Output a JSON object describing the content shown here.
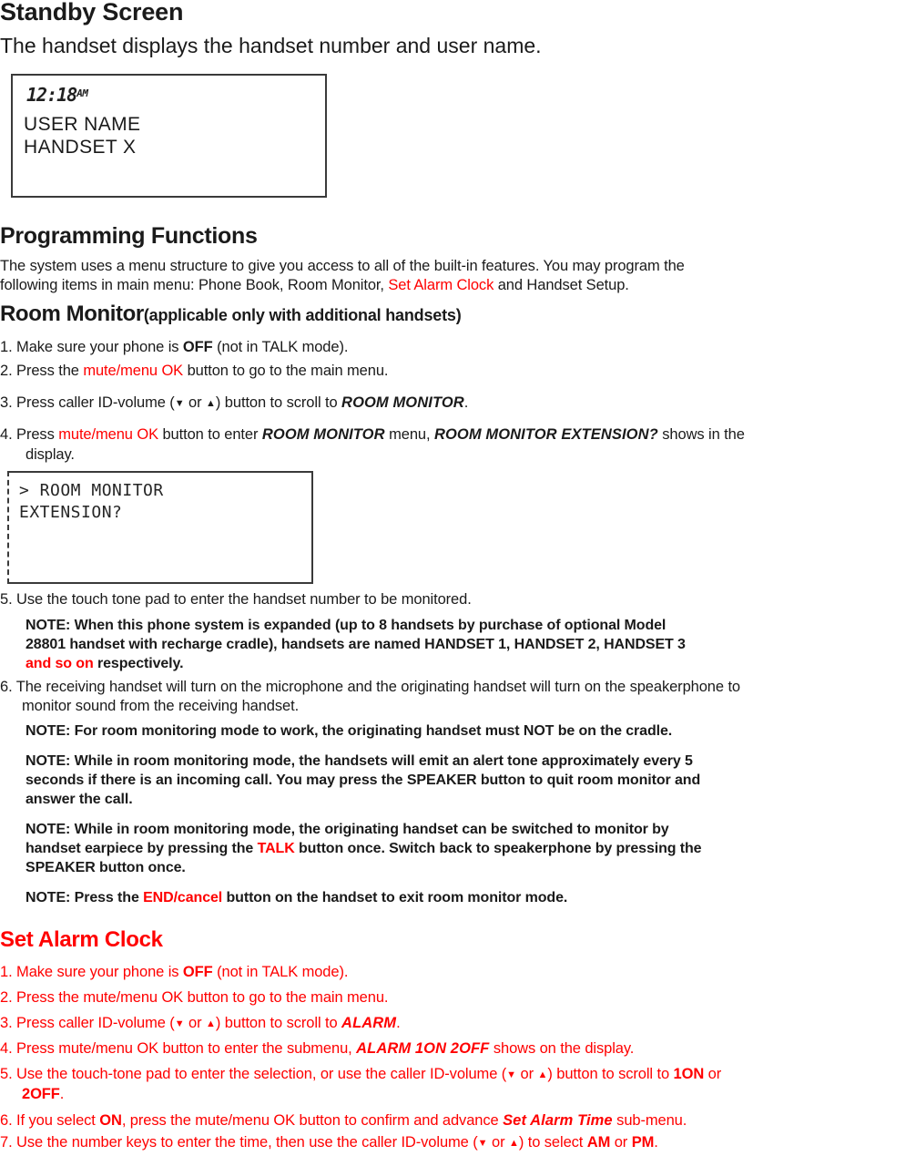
{
  "doc": {
    "standby": {
      "heading": "Standby Screen",
      "subtitle": "The handset displays the handset number and user name.",
      "lcd": {
        "time": "12:18",
        "ampm": "AM",
        "line1": "USER NAME",
        "line2": "HANDSET  X"
      }
    },
    "programming": {
      "heading": "Programming Functions",
      "intro_1": "The system uses a menu structure to give you access to all of the built-in features. You may program the",
      "intro_2_a": "following items in main menu: Phone Book, Room Monitor, ",
      "intro_2_red": "Set Alarm Clock",
      "intro_2_b": " and Handset Setup."
    },
    "room_monitor": {
      "heading": "Room Monitor",
      "heading_paren": "(applicable only with additional handsets)",
      "step1_a": "1. Make sure your phone is ",
      "step1_bold": "OFF",
      "step1_b": " (not in TALK mode).",
      "step2_a": "2. Press the ",
      "step2_red": "mute/menu OK",
      "step2_b": " button to go to the main menu.",
      "step3_a": "3. Press caller ID-volume (",
      "step3_down": "▼",
      "step3_or": " or ",
      "step3_up": "▲",
      "step3_b": ") button to scroll to ",
      "step3_bi": "ROOM MONITOR",
      "step3_c": ".",
      "step4_a": "4. Press ",
      "step4_red": "mute/menu OK",
      "step4_b": " button to enter ",
      "step4_bi1": "ROOM MONITOR",
      "step4_c": " menu, ",
      "step4_bi2": "ROOM MONITOR EXTENSION?",
      "step4_d": " shows in the",
      "step4_e": "display.",
      "lcd": {
        "line1": "> ROOM MONITOR",
        "line2": "EXTENSION?"
      },
      "step5": "5. Use the touch tone pad to enter the handset number to be monitored.",
      "note1_l1": "NOTE: When this phone system is expanded (up to 8 handsets by purchase of optional Model",
      "note1_l2": "28801 handset with recharge cradle), handsets are named HANDSET 1, HANDSET 2, HANDSET 3",
      "note1_l3_red": "and so on",
      "note1_l3_b": " respectively.",
      "step6_l1": "6. The receiving handset will turn on the microphone and the originating handset will turn on the speakerphone to",
      "step6_l2": "monitor sound from the receiving handset.",
      "note2": "NOTE: For room monitoring mode to work, the originating handset must NOT be on the cradle.",
      "note3_l1": "NOTE: While in room monitoring mode, the handsets will emit an alert tone approximately every 5",
      "note3_l2": "seconds if there is an incoming call. You may press the SPEAKER button to quit room monitor and",
      "note3_l3": "answer the call.",
      "note4_l1": "NOTE: While in room monitoring mode, the originating handset can be switched to monitor by",
      "note4_l2_a": "handset earpiece by pressing the ",
      "note4_l2_red": "TALK",
      "note4_l2_b": " button once. Switch back to speakerphone by pressing the",
      "note4_l3": "SPEAKER button once.",
      "note5_a": "NOTE: Press the ",
      "note5_red": "END/cancel",
      "note5_b": " button on the handset to exit room monitor mode."
    },
    "set_alarm_clock": {
      "heading": "Set Alarm Clock",
      "step1_a": "1. Make sure your phone is ",
      "step1_bold": "OFF",
      "step1_b": " (not in TALK mode).",
      "step2": "2. Press the mute/menu OK button to go to the main menu.",
      "step3_a": "3. Press caller ID-volume (",
      "step3_down": "▼",
      "step3_or": " or ",
      "step3_up": "▲",
      "step3_b": ") button to scroll to ",
      "step3_bi": "ALARM",
      "step3_c": ".",
      "step4_a": "4. Press mute/menu OK button to enter the submenu, ",
      "step4_bi": "ALARM 1ON 2OFF",
      "step4_b": " shows on the display.",
      "step5_a": "5. Use the touch-tone pad to enter the selection, or use the caller ID-volume (",
      "step5_down": "▼",
      "step5_or": " or ",
      "step5_up": "▲",
      "step5_b": ") button to scroll to ",
      "step5_bold1": "1ON",
      "step5_c": " or",
      "step5_bold2": "2OFF",
      "step5_d": ".",
      "step6_a": "6. If you select ",
      "step6_bold": "ON",
      "step6_b": ", press the mute/menu OK button to confirm and advance ",
      "step6_bi": "Set Alarm Time",
      "step6_c": " sub-menu.",
      "step7_a": "7. Use the number keys to enter the time, then use the caller ID-volume (",
      "step7_down": "▼",
      "step7_or": " or ",
      "step7_up": "▲",
      "step7_b": ") to select ",
      "step7_bold1": "AM",
      "step7_c": " or ",
      "step7_bold2": "PM",
      "step7_d": "."
    },
    "colors": {
      "accent_red": "#ff0000",
      "text": "#1a1a1a",
      "lcd_border": "#3a3a3a"
    }
  }
}
